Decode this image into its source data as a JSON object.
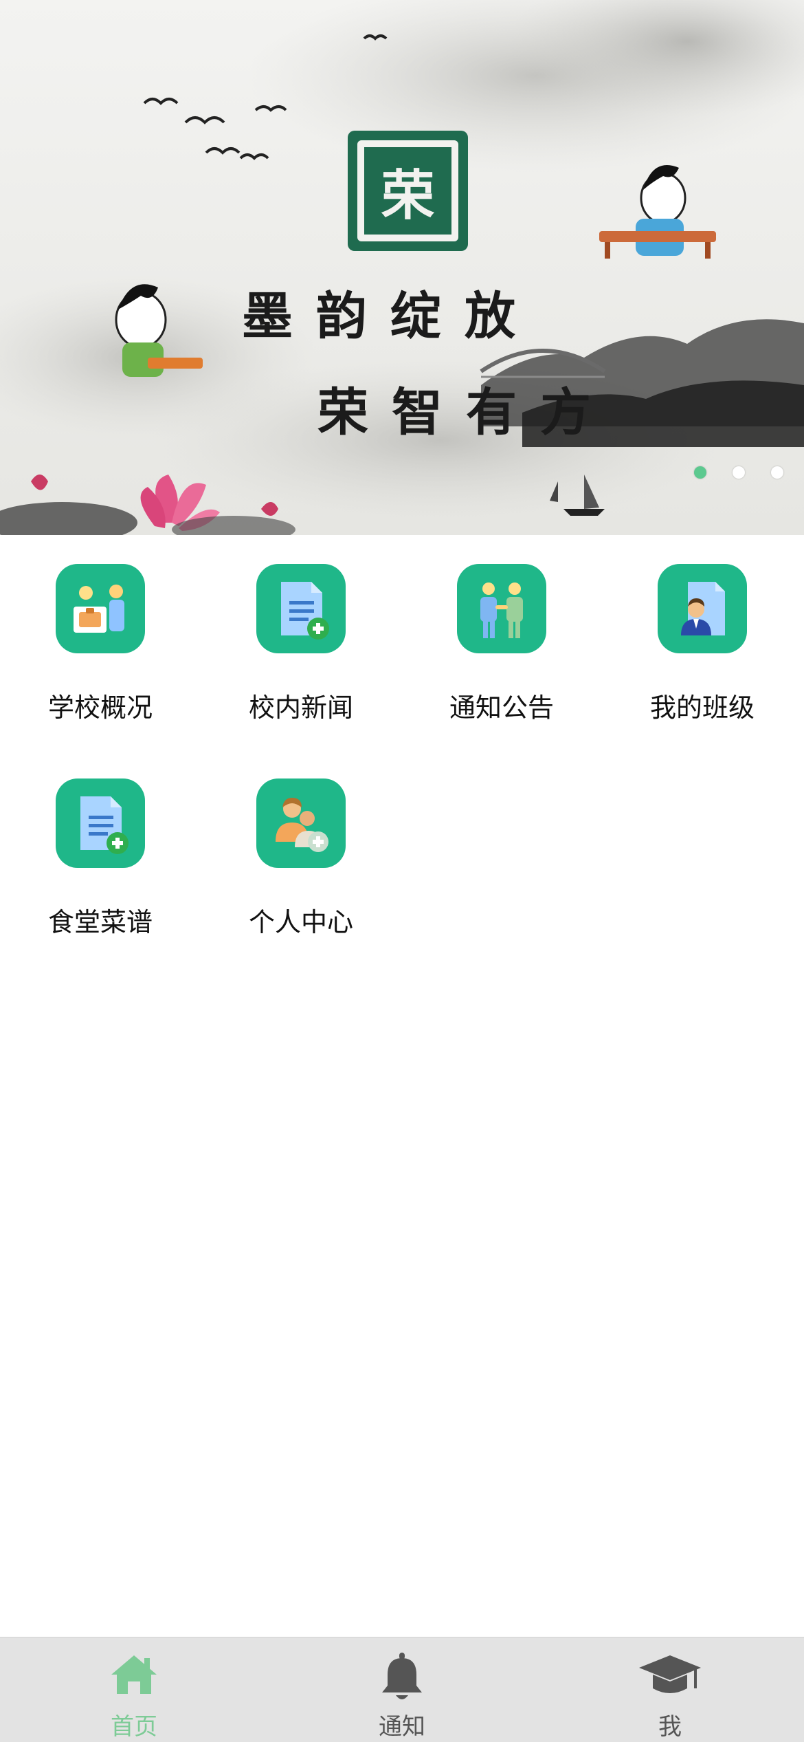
{
  "banner": {
    "seal_text": "荣",
    "slogan_line1": "墨韵绽放",
    "slogan_line2": "荣智有方",
    "slide_count": 3,
    "active_slide": 1
  },
  "grid": {
    "items": [
      {
        "label": "学校概况",
        "icon": "school-overview-icon"
      },
      {
        "label": "校内新闻",
        "icon": "news-document-add-icon"
      },
      {
        "label": "通知公告",
        "icon": "notice-people-icon"
      },
      {
        "label": "我的班级",
        "icon": "class-person-document-icon"
      },
      {
        "label": "食堂菜谱",
        "icon": "menu-document-add-icon"
      },
      {
        "label": "个人中心",
        "icon": "personal-center-users-icon"
      }
    ]
  },
  "tabbar": {
    "items": [
      {
        "label": "首页",
        "icon": "home-icon",
        "active": true
      },
      {
        "label": "通知",
        "icon": "bell-icon",
        "active": false
      },
      {
        "label": "我",
        "icon": "graduation-cap-icon",
        "active": false
      }
    ]
  },
  "colors": {
    "accent": "#1fb789",
    "tab_active": "#7dcb96",
    "tab_inactive": "#555555",
    "tabbar_bg": "#e3e3e3"
  }
}
